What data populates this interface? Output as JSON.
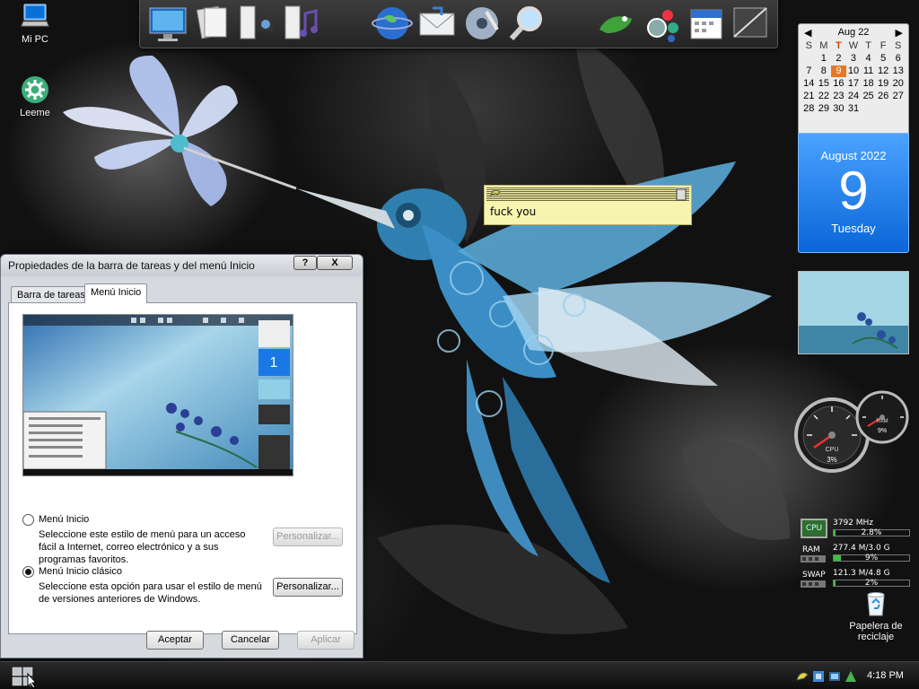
{
  "desktop": {
    "icons": [
      {
        "label": "Mi PC"
      },
      {
        "label": "Leeme"
      },
      {
        "label": "Papelera de reciclaje"
      }
    ]
  },
  "calendar": {
    "month_label": "Aug 22",
    "weekdays": [
      "S",
      "M",
      "T",
      "W",
      "T",
      "F",
      "S"
    ],
    "weeks": [
      [
        "",
        "1",
        "2",
        "3",
        "4",
        "5",
        "6"
      ],
      [
        "7",
        "8",
        "9",
        "10",
        "11",
        "12",
        "13"
      ],
      [
        "14",
        "15",
        "16",
        "17",
        "18",
        "19",
        "20"
      ],
      [
        "21",
        "22",
        "23",
        "24",
        "25",
        "26",
        "27"
      ],
      [
        "28",
        "29",
        "30",
        "31",
        "",
        "",
        ""
      ]
    ],
    "today": "9",
    "day_month": "August 2022",
    "day_number": "9",
    "day_weekday": "Tuesday",
    "accent": "#1a78e6"
  },
  "note": {
    "text": "fuck you",
    "color": "#f7f4b0"
  },
  "cpu_meter": {
    "cpu_label": "CPU",
    "cpu_value": "3%",
    "ram_label": "RAM",
    "ram_value": "9%"
  },
  "sysmon": {
    "cpu_chip": "CPU",
    "cpu_freq": "3792 MHz",
    "cpu_pct": "2.8%",
    "cpu_fraction": 0.028,
    "ram_label": "RAM",
    "ram_value": "277.4 M/3.0 G",
    "ram_pct": "9%",
    "ram_fraction": 0.09,
    "swap_label": "SWAP",
    "swap_value": "121.3 M/4.8 G",
    "swap_pct": "2%",
    "swap_fraction": 0.02
  },
  "dialog": {
    "title": "Propiedades de la barra de tareas y del menú Inicio",
    "help_label": "?",
    "close_label": "X",
    "tabs": [
      {
        "label": "Barra de tareas"
      },
      {
        "label": "Menú Inicio"
      }
    ],
    "options": [
      {
        "label": "Menú Inicio",
        "description": "Seleccione este estilo de menú para un acceso fácil a Internet, correo electrónico y a sus programas favoritos.",
        "button": "Personalizar...",
        "selected": false
      },
      {
        "label": "Menú Inicio clásico",
        "description": "Seleccione esta opción para usar el estilo de menú de versiones anteriores de Windows.",
        "button": "Personalizar...",
        "selected": true
      }
    ],
    "buttons": {
      "ok": "Aceptar",
      "cancel": "Cancelar",
      "apply": "Aplicar"
    },
    "preview": {
      "cal_number": "1"
    }
  },
  "taskbar": {
    "clock": "4:18 PM"
  }
}
